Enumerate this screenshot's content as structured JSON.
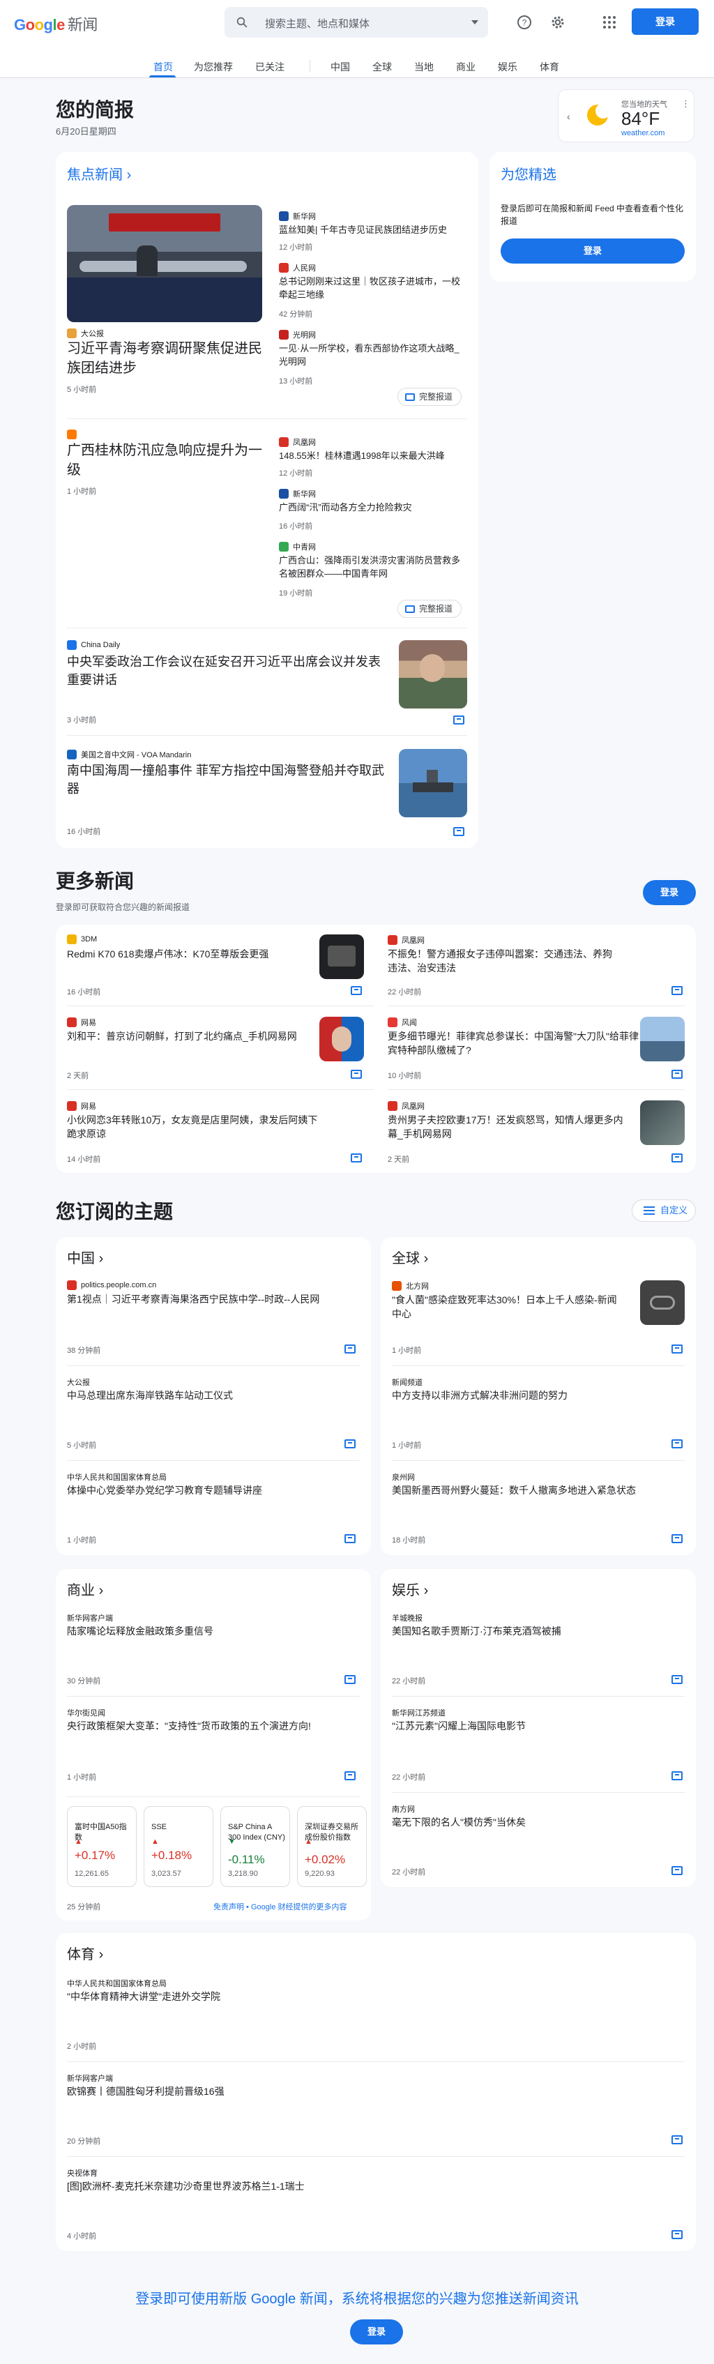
{
  "header": {
    "logo_google": "Google",
    "logo_news": "新闻",
    "search_placeholder": "搜索主题、地点和媒体",
    "signin": "登录",
    "nav": [
      "首页",
      "为您推荐",
      "已关注",
      "中国",
      "全球",
      "当地",
      "商业",
      "娱乐",
      "体育"
    ]
  },
  "briefing": {
    "title": "您的简报",
    "date": "6月20日星期四",
    "weather_label": "您当地的天气",
    "weather_temp": "84°F",
    "weather_source": "weather.com"
  },
  "headlines": {
    "title": "焦点新闻",
    "full_coverage": "完整报道",
    "cluster1": {
      "main_source": "大公报",
      "main_title": "习近平青海考察调研聚焦促进民族团结进步",
      "main_time": "5 小时前",
      "subs": [
        {
          "source": "新华网",
          "title": "蓝丝知美| 千年古寺见证民族团结进步历史",
          "time": "12 小时前"
        },
        {
          "source": "人民网",
          "title": "总书记刚刚来过这里｜牧区孩子进城市，一校牵起三地缘",
          "time": "42 分钟前"
        },
        {
          "source": "光明网",
          "title": "一见·从一所学校，看东西部协作这项大战略_光明网",
          "time": "13 小时前"
        }
      ]
    },
    "cluster2": {
      "main_title": "广西桂林防汛应急响应提升为一级",
      "main_time": "1 小时前",
      "subs": [
        {
          "source": "凤凰网",
          "title": "148.55米！桂林遭遇1998年以来最大洪峰",
          "time": "12 小时前"
        },
        {
          "source": "新华网",
          "title": "广西阔“汛”而动各方全力抢险救灾",
          "time": "16 小时前"
        },
        {
          "source": "中青网",
          "title": "广西合山：强降雨引发洪涝灾害消防员营救多名被困群众——中国青年网",
          "time": "19 小时前"
        }
      ]
    },
    "story3": {
      "source": "China Daily",
      "title": "中央军委政治工作会议在延安召开习近平出席会议并发表重要讲话",
      "time": "3 小时前"
    },
    "story4": {
      "source": "美国之音中文网 - VOA Mandarin",
      "title": "南中国海周一撞船事件 菲军方指控中国海警登船并夺取武器",
      "time": "16 小时前"
    }
  },
  "picks": {
    "title": "为您精选",
    "text": "登录后即可在简报和新闻 Feed 中查看查看个性化报道",
    "button": "登录"
  },
  "more_news": {
    "title": "更多新闻",
    "subtitle": "登录即可获取符合您兴趣的新闻报道",
    "button": "登录",
    "items": [
      {
        "source": "3DM",
        "title": "Redmi K70 618卖爆卢伟冰：K70至尊版会更强",
        "time": "16 小时前"
      },
      {
        "source": "凤凰网",
        "title": "不振免！警方通报女子违停叫嚣案：交通违法、养狗违法、治安违法",
        "time": "22 小时前"
      },
      {
        "source": "网易",
        "title": "刘和平：普京访问朝鲜，打到了北约痛点_手机网易网",
        "time": "2 天前"
      },
      {
        "source": "风闻",
        "title": "更多细节曝光！菲律宾总参谋长：中国海警\"大刀队\"给菲律宾特种部队缴械了?",
        "time": "10 小时前"
      },
      {
        "source": "网易",
        "title": "小伙网恋3年转账10万，女友竟是店里阿姨，隶发后阿姨下跪求原谅",
        "time": "14 小时前"
      },
      {
        "source": "凤凰网",
        "title": "贵州男子夫控欧妻17万！还发疯怒骂，知情人爆更多内幕_手机网易网",
        "time": "2 天前"
      }
    ]
  },
  "topics": {
    "title": "您订阅的主题",
    "customize": "自定义",
    "china": {
      "title": "中国",
      "items": [
        {
          "source": "politics.people.com.cn",
          "title": "第1视点｜习近平考察青海果洛西宁民族中学--时政--人民网",
          "time": "38 分钟前"
        },
        {
          "source": "大公报",
          "title": "中马总理出席东海岸铁路车站动工仪式",
          "time": "5 小时前"
        },
        {
          "source": "中华人民共和国国家体育总局",
          "title": "体操中心党委举办党纪学习教育专题辅导讲座",
          "time": "1 小时前"
        }
      ]
    },
    "world": {
      "title": "全球",
      "items": [
        {
          "source": "北方网",
          "title": "\"食人菌\"感染症致死率达30%！日本上千人感染-新闻中心",
          "time": "1 小时前"
        },
        {
          "source": "新闻频道",
          "title": "中方支持以非洲方式解决非洲问题的努力",
          "time": "1 小时前"
        },
        {
          "source": "泉州网",
          "title": "美国新墨西哥州野火蔓延：数千人撤离多地进入紧急状态",
          "time": "18 小时前"
        }
      ]
    },
    "business": {
      "title": "商业",
      "items": [
        {
          "source": "新华网客户端",
          "title": "陆家嘴论坛释放金融政策多重信号",
          "time": "30 分钟前"
        },
        {
          "source": "华尔街见闻",
          "title": "央行政策框架大变革：\"支持性\"货币政策的五个演进方向!",
          "time": "1 小时前"
        }
      ],
      "stocks": [
        {
          "name": "富时中国A50指数",
          "change": "+0.17%",
          "value": "12,261.65",
          "dir": "up"
        },
        {
          "name": "SSE",
          "change": "+0.18%",
          "value": "3,023.57",
          "dir": "up"
        },
        {
          "name": "S&P China A 300 Index (CNY)",
          "change": "-0.11%",
          "value": "3,218.90",
          "dir": "down"
        },
        {
          "name": "深圳证券交易所成份股价指数",
          "change": "+0.02%",
          "value": "9,220.93",
          "dir": "up"
        }
      ],
      "stocks_time": "25 分钟前",
      "disclaimer": "免责声明 • Google 财经提供的更多内容"
    },
    "entertainment": {
      "title": "娱乐",
      "items": [
        {
          "source": "羊城晚报",
          "title": "美国知名歌手贾斯汀·汀布莱克酒驾被捕",
          "time": "22 小时前"
        },
        {
          "source": "新华网江苏频道",
          "title": "\"江苏元素\"闪耀上海国际电影节",
          "time": "22 小时前"
        },
        {
          "source": "南方网",
          "title": "毫无下限的名人\"模仿秀\"当休矣",
          "time": "22 小时前"
        }
      ]
    },
    "sports": {
      "title": "体育",
      "items": [
        {
          "source": "中华人民共和国国家体育总局",
          "title": "\"中华体育精神大讲堂\"走进外交学院",
          "time": "2 小时前"
        },
        {
          "source": "新华网客户端",
          "title": "欧锦赛丨德国胜匈牙利提前晋级16强",
          "time": "20 分钟前"
        },
        {
          "source": "央视体育",
          "title": "[图]欧洲杯-麦克托米奈建功沙奇里世界波苏格兰1-1瑞士",
          "time": "4 小时前"
        }
      ]
    }
  },
  "footer": {
    "cta": "登录即可使用新版 Google 新闻，系统将根据您的兴趣为您推送新闻资讯",
    "button": "登录"
  },
  "colors": {
    "accent": "#1a73e8",
    "up": "#d93025",
    "down": "#188038",
    "bg": "#f6f8fc"
  }
}
